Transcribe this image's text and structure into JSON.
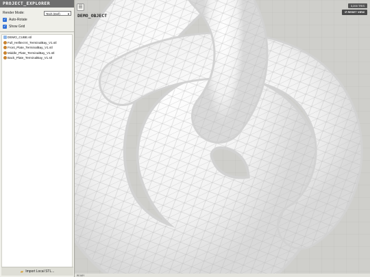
{
  "sidebar": {
    "title": "PROJECT_EXPLORER",
    "render_mode_label": "Render Mode:",
    "render_mode_value": "Tech (Def)",
    "auto_rotate_label": "Auto-Rotate",
    "show_grid_label": "Show Grid",
    "files": [
      {
        "name": "DEMO_CUBE.stl",
        "icon": "cube-file-icon"
      },
      {
        "name": "Full_HelltecV4_TerminalBay_V1.stl",
        "icon": "stl-file-icon"
      },
      {
        "name": "Front_Plate_TerminalBay_V1.stl",
        "icon": "stl-file-icon"
      },
      {
        "name": "Middle_Plate_TerminalBay_V1.stl",
        "icon": "stl-file-icon"
      },
      {
        "name": "Back_Plate_TerminalBay_V1.stl",
        "icon": "stl-file-icon"
      }
    ],
    "import_label": "Import Local STL..."
  },
  "viewport": {
    "menu_icon": "menu-icon",
    "object_label": "DEMO_OBJECT",
    "tris_label": "3,200 TRIS",
    "reset_label": "↺ RESET VIEW",
    "status_text": "READY"
  },
  "colors": {
    "sidebar_bg": "#efefe9",
    "title_bar": "#6e6e6e",
    "accent_checkbox": "#2f6fd6",
    "model_surface": "#f5f5f5",
    "wireframe": "#bdbdbd"
  }
}
